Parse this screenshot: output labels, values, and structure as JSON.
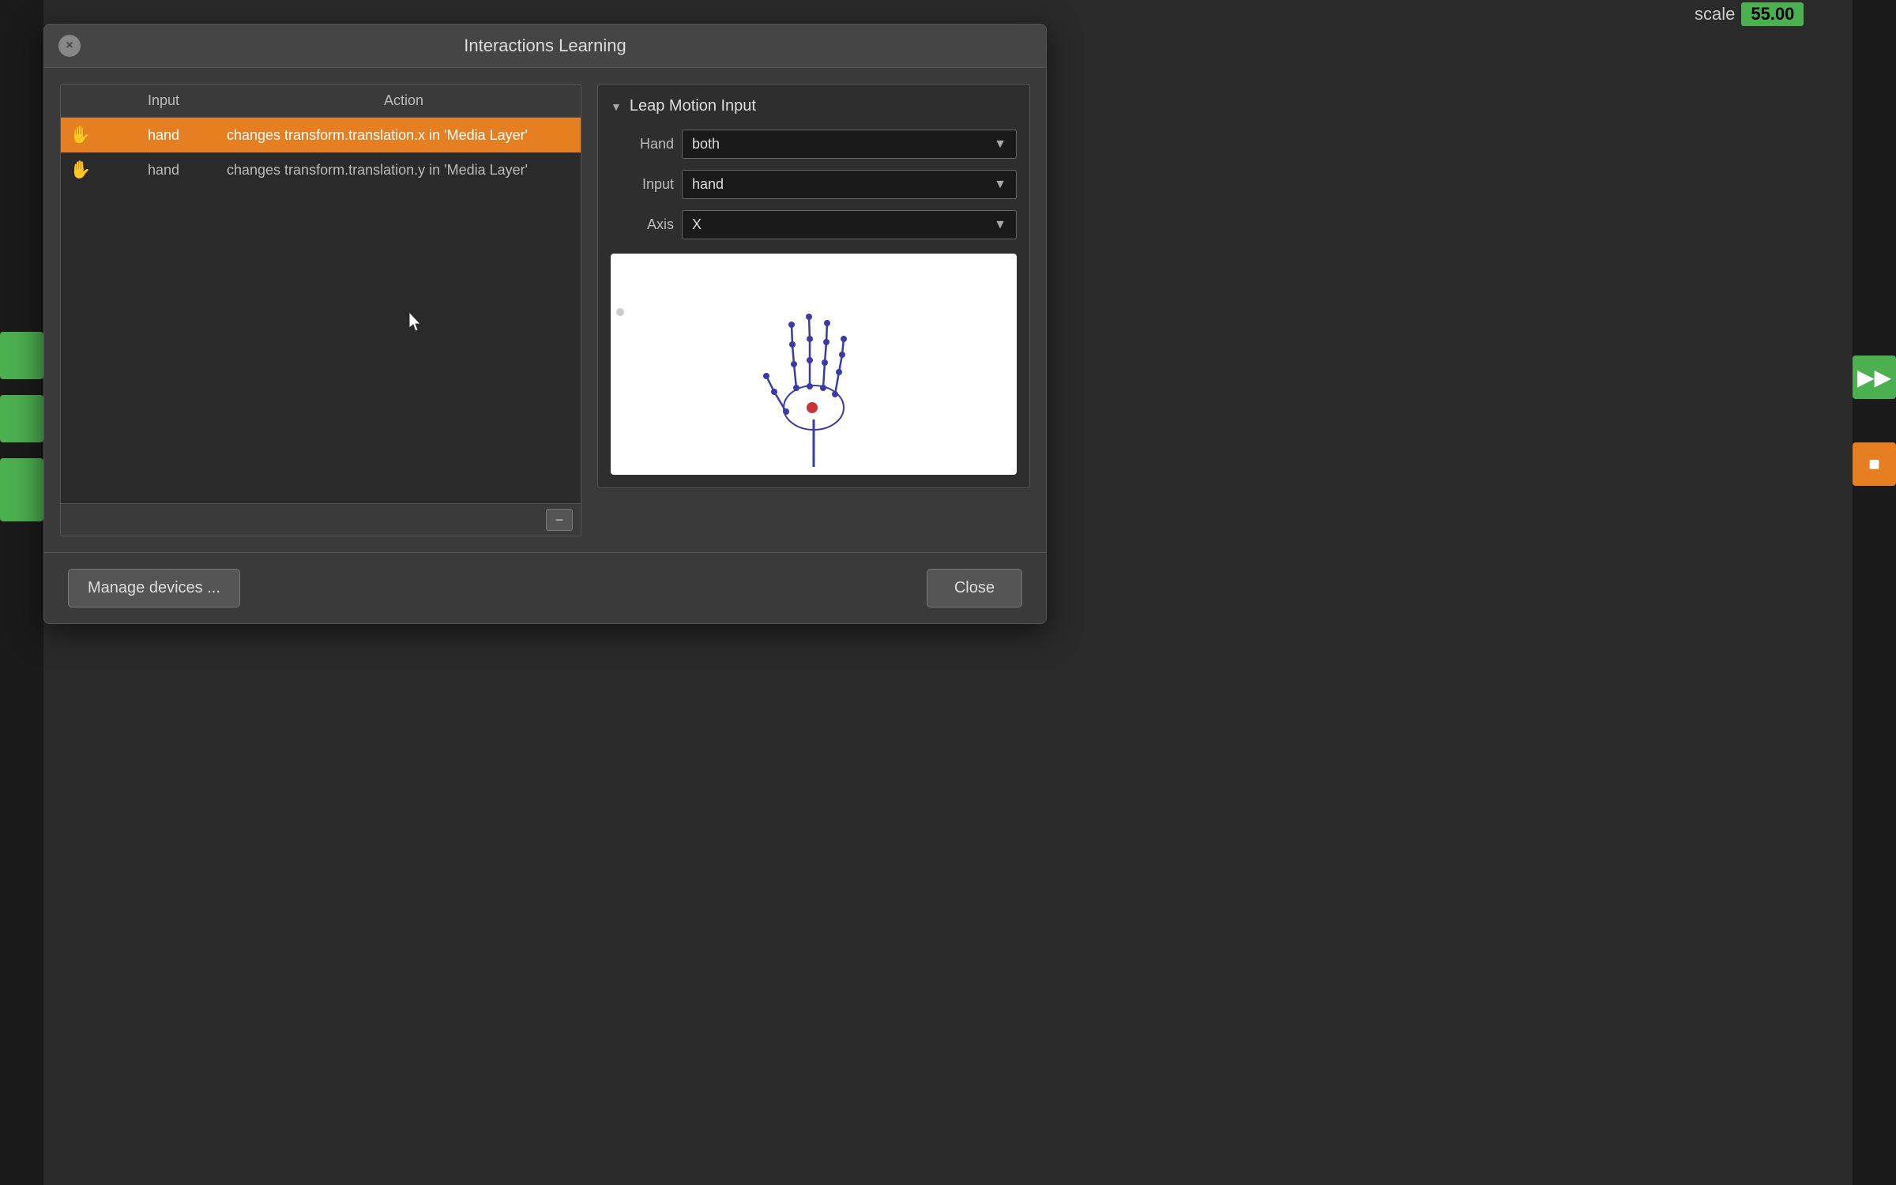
{
  "dialog": {
    "title": "Interactions Learning",
    "close_button": "×"
  },
  "table": {
    "columns": {
      "icon": "",
      "input": "Input",
      "action": "Action"
    },
    "rows": [
      {
        "icon": "✋",
        "input": "hand",
        "action": "changes transform.translation.x in 'Media Layer'",
        "selected": true
      },
      {
        "icon": "✋",
        "input": "hand",
        "action": "changes transform.translation.y in 'Media Layer'",
        "selected": false
      }
    ],
    "minus_button": "−"
  },
  "leap_motion": {
    "section_title": "Leap Motion Input",
    "fields": {
      "hand_label": "Hand",
      "hand_value": "both",
      "input_label": "Input",
      "input_value": "hand",
      "axis_label": "Axis",
      "axis_value": "X"
    }
  },
  "bottom_bar": {
    "manage_label": "Manage devices ...",
    "close_label": "Close"
  },
  "scale": {
    "label": "scale",
    "value": "55.00"
  }
}
